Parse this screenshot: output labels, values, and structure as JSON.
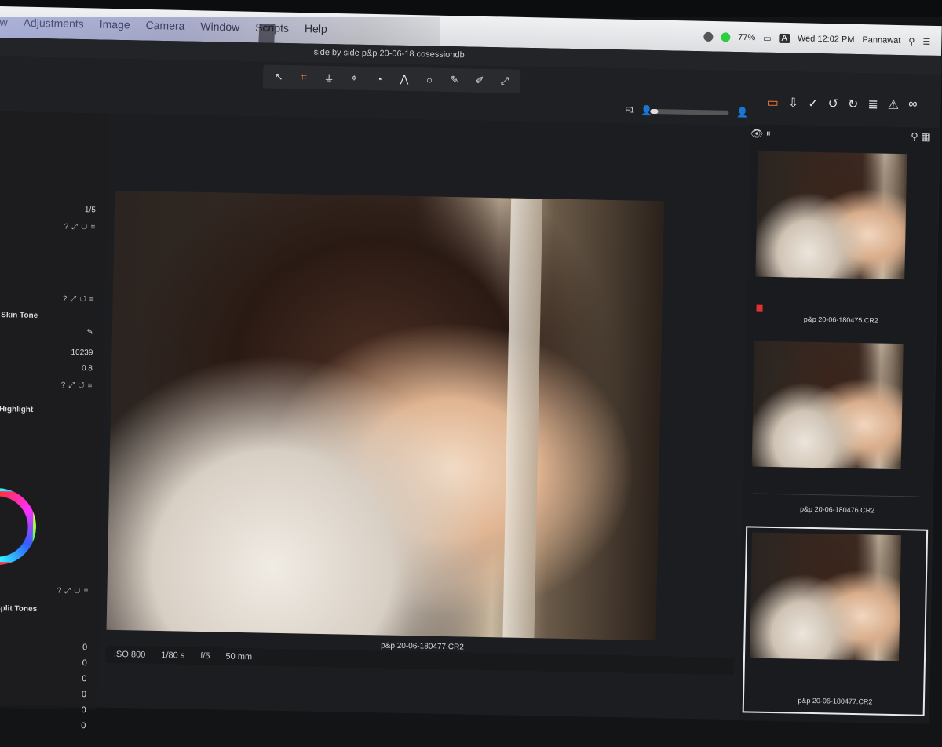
{
  "menubar": {
    "items": [
      "w",
      "Adjustments",
      "Image",
      "Camera",
      "Window",
      "Scripts",
      "Help"
    ],
    "battery": "77%",
    "datetime": "Wed 12:02 PM",
    "user": "Pannawat",
    "input_badge": "A"
  },
  "window": {
    "title": "side by side p&p 20-06-18.cosessiondb"
  },
  "toolbar": {
    "tools": [
      "pointer-icon",
      "crop-icon",
      "straighten-icon",
      "keystone-icon",
      "spot-icon",
      "mask-icon",
      "circle-icon",
      "brush-icon",
      "eyedropper-icon",
      "picker-icon"
    ]
  },
  "left_panel": {
    "values": [
      "1/5",
      "10239",
      "0.8"
    ],
    "sections": [
      "Skin Tone",
      "Highlight",
      "Split Tones"
    ],
    "numbers": [
      "0",
      "0",
      "0",
      "0",
      "0",
      "0"
    ]
  },
  "viewer": {
    "label_f1": "F1",
    "zoom_fraction": 0.1,
    "filename": "p&p 20-06-180477.CR2",
    "info": {
      "iso": "ISO 800",
      "shutter": "1/80 s",
      "aperture": "f/5",
      "focal": "50 mm"
    }
  },
  "browser": {
    "thumbnails": [
      {
        "label": "p&p 20-06-180475.CR2",
        "tagged": true,
        "selected": false
      },
      {
        "label": "p&p 20-06-180476.CR2",
        "tagged": false,
        "selected": false
      },
      {
        "label": "p&p 20-06-180477.CR2",
        "tagged": false,
        "selected": true
      }
    ]
  },
  "colors": {
    "accent": "#ff7a3a",
    "tag_red": "#e03030"
  }
}
